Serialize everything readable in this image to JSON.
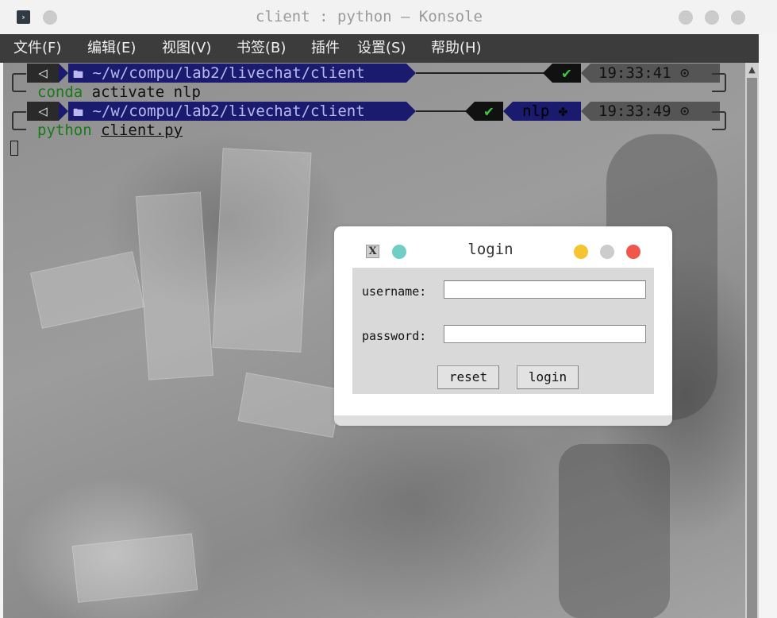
{
  "window": {
    "title": "client : python — Konsole",
    "app_icon": "›"
  },
  "menubar": {
    "items": [
      "文件(F)",
      "编辑(E)",
      "视图(V)",
      "书签(B)",
      "插件",
      "设置(S)",
      "帮助(H)"
    ]
  },
  "terminal": {
    "prompts": [
      {
        "os_icon": "◁",
        "folder_icon": "🖿",
        "path": "~/w/compu/lab2/livechat/client",
        "status": "✔",
        "env": "",
        "time": "19:33:41 ⊙",
        "command_keyword": "conda",
        "command_rest": " activate nlp"
      },
      {
        "os_icon": "◁",
        "folder_icon": "🖿",
        "path": "~/w/compu/lab2/livechat/client",
        "status": "✔",
        "env": "nlp ✤",
        "time": "19:33:49 ⊙",
        "command_keyword": "python",
        "command_arg": "client.py"
      }
    ]
  },
  "dialog": {
    "title": "login",
    "icon_glyph": "X",
    "username_label": "username:",
    "username_value": "",
    "password_label": "password:",
    "password_value": "",
    "reset_label": "reset",
    "login_label": "login",
    "colors": {
      "teal": "#6fcfc4",
      "yellow": "#f5c431",
      "gray": "#cccccc",
      "red": "#f0564b"
    }
  },
  "colors": {
    "menubar_bg": "#3c3c3c",
    "prompt_path_bg": "#1a1a6e",
    "command_green": "#187a18"
  }
}
